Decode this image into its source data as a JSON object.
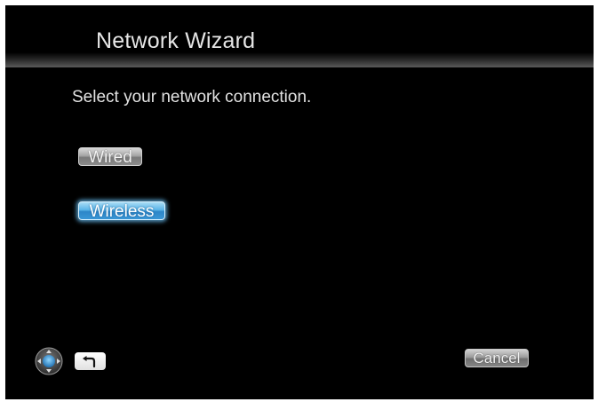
{
  "header": {
    "title": "Network Wizard"
  },
  "main": {
    "prompt": "Select your network connection.",
    "options": [
      {
        "label": "Wired",
        "selected": false
      },
      {
        "label": "Wireless",
        "selected": true
      }
    ]
  },
  "footer": {
    "icons": [
      "dpad-icon",
      "back-arrow-icon"
    ],
    "cancel_label": "Cancel"
  },
  "colors": {
    "background": "#000000",
    "text": "#e2e2e2",
    "selected_accent": "#5ab5e8"
  }
}
